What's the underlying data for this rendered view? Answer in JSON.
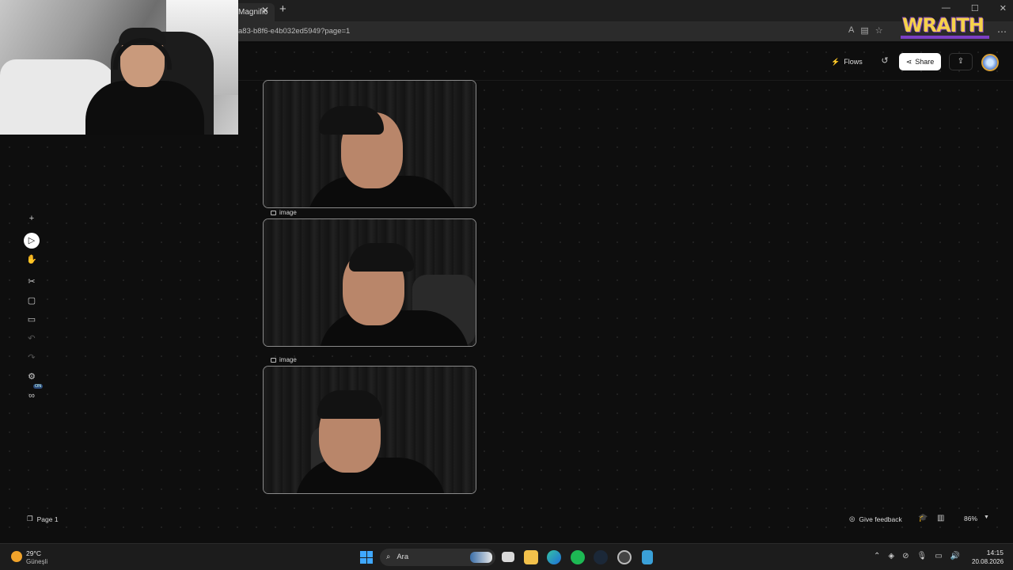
{
  "browser": {
    "tab_title": "Magnific",
    "url": "a83-b8f6-e4b032ed5949?page=1",
    "overlay_logo": "WRAITH"
  },
  "header": {
    "flows_label": "Flows",
    "share_label": "Share"
  },
  "canvas": {
    "image_labels": [
      "image",
      "image"
    ]
  },
  "footer": {
    "page_label": "Page 1",
    "feedback_label": "Give feedback",
    "zoom_value": "86%"
  },
  "tools": {
    "on_badge": "ON"
  },
  "taskbar": {
    "weather_temp": "29°C",
    "weather_desc": "Güneşli",
    "search_placeholder": "Ara",
    "time": "14:15",
    "date": "20.08.2026"
  },
  "colors": {
    "accent_share_bg": "#ffffff",
    "logo_yellow": "#f5d24a",
    "logo_purple": "#7b3fc4"
  }
}
